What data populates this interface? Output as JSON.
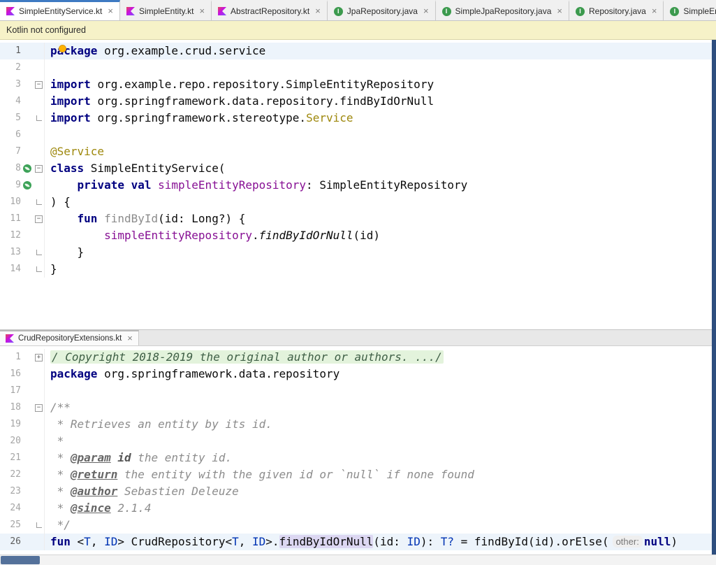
{
  "notification": {
    "text": "Kotlin not configured"
  },
  "icons": {
    "close": "×",
    "fold_minus": "−",
    "fold_plus": "+"
  },
  "colors": {
    "accent_blue": "#3E7AC2",
    "notification_bg": "#F6F2C8",
    "caret_line_bg": "#EDF4FB",
    "keyword": "#000080",
    "annotation": "#9E880D",
    "property": "#871094",
    "comment": "#8C8C8C",
    "folded_region_bg": "#E3F3DC",
    "declaration_highlight": "#DCD7F2",
    "spring_green": "#3DA258",
    "scrollbar_thumb_blue": "#54719A",
    "right_stripe_navy": "#2E4E7E"
  },
  "tabs": [
    {
      "label": "SimpleEntityService.kt",
      "icon": "kotlin",
      "active": true
    },
    {
      "label": "SimpleEntity.kt",
      "icon": "kotlin",
      "active": false
    },
    {
      "label": "AbstractRepository.kt",
      "icon": "kotlin",
      "active": false
    },
    {
      "label": "JpaRepository.java",
      "icon": "interface",
      "active": false
    },
    {
      "label": "SimpleJpaRepository.java",
      "icon": "interface",
      "active": false
    },
    {
      "label": "Repository.java",
      "icon": "interface",
      "active": false
    },
    {
      "label": "SimpleEntityRe",
      "icon": "interface",
      "active": false
    }
  ],
  "bottom_tab": {
    "label": "CrudRepositoryExtensions.kt",
    "icon": "kotlin",
    "active": true
  },
  "editors": [
    {
      "name": "SimpleEntityService.kt",
      "lines": [
        {
          "num": "1",
          "caret": true,
          "tokens": [
            [
              "kw",
              "package "
            ],
            [
              "pl",
              "org.example.crud.service"
            ]
          ]
        },
        {
          "num": "2",
          "tokens": []
        },
        {
          "num": "3",
          "fold": "minus",
          "tokens": [
            [
              "kw",
              "import "
            ],
            [
              "pl",
              "org.example.repo.repository.SimpleEntityRepository"
            ]
          ]
        },
        {
          "num": "4",
          "tokens": [
            [
              "kw",
              "import "
            ],
            [
              "pl",
              "org.springframework.data.repository.findByIdOrNull"
            ]
          ]
        },
        {
          "num": "5",
          "fold": "end",
          "tokens": [
            [
              "kw",
              "import "
            ],
            [
              "pl",
              "org.springframework.stereotype."
            ],
            [
              "ann",
              "Service"
            ]
          ]
        },
        {
          "num": "6",
          "tokens": []
        },
        {
          "num": "7",
          "tokens": [
            [
              "ann",
              "@Service"
            ]
          ]
        },
        {
          "num": "8",
          "gutter": [
            "spring"
          ],
          "fold": "minus",
          "tokens": [
            [
              "kw",
              "class "
            ],
            [
              "pl",
              "SimpleEntityService("
            ]
          ]
        },
        {
          "num": "9",
          "gutter": [
            "spring"
          ],
          "tokens": [
            [
              "pl",
              "    "
            ],
            [
              "kw",
              "private "
            ],
            [
              "kw",
              "val "
            ],
            [
              "prop",
              "simpleEntityRepository"
            ],
            [
              "pl",
              ": SimpleEntityRepository"
            ]
          ]
        },
        {
          "num": "10",
          "fold": "end",
          "tokens": [
            [
              "pl",
              ") {"
            ]
          ]
        },
        {
          "num": "11",
          "fold": "minus",
          "tokens": [
            [
              "pl",
              "    "
            ],
            [
              "kw",
              "fun "
            ],
            [
              "gray",
              "findById"
            ],
            [
              "pl",
              "(id: Long?) {"
            ]
          ]
        },
        {
          "num": "12",
          "tokens": [
            [
              "pl",
              "        "
            ],
            [
              "prop",
              "simpleEntityRepository"
            ],
            [
              "pl",
              "."
            ],
            [
              "ext",
              "findByIdOrNull"
            ],
            [
              "pl",
              "(id)"
            ]
          ]
        },
        {
          "num": "13",
          "fold": "end",
          "tokens": [
            [
              "pl",
              "    }"
            ]
          ]
        },
        {
          "num": "14",
          "fold": "end",
          "tokens": [
            [
              "pl",
              "}"
            ]
          ]
        }
      ]
    },
    {
      "name": "CrudRepositoryExtensions.kt",
      "lines": [
        {
          "num": "1",
          "fold": "plus",
          "tokens": [
            [
              "folded",
              "/ Copyright 2018-2019 the original author or authors. .../"
            ]
          ]
        },
        {
          "num": "16",
          "tokens": [
            [
              "kw",
              "package "
            ],
            [
              "pl",
              "org.springframework.data.repository"
            ]
          ]
        },
        {
          "num": "17",
          "tokens": []
        },
        {
          "num": "18",
          "fold": "minus",
          "tokens": [
            [
              "cmt",
              "/**"
            ]
          ]
        },
        {
          "num": "19",
          "tokens": [
            [
              "cmt",
              " * Retrieves an entity by its id."
            ]
          ]
        },
        {
          "num": "20",
          "tokens": [
            [
              "cmt",
              " *"
            ]
          ]
        },
        {
          "num": "21",
          "tokens": [
            [
              "cmt",
              " * "
            ],
            [
              "tag",
              "@param"
            ],
            [
              "tagval",
              " id"
            ],
            [
              "cmt",
              " the entity id."
            ]
          ]
        },
        {
          "num": "22",
          "tokens": [
            [
              "cmt",
              " * "
            ],
            [
              "tag",
              "@return"
            ],
            [
              "cmt",
              " the entity with the given id or `null` if none found"
            ]
          ]
        },
        {
          "num": "23",
          "tokens": [
            [
              "cmt",
              " * "
            ],
            [
              "tag",
              "@author"
            ],
            [
              "cmt",
              " Sebastien Deleuze"
            ]
          ]
        },
        {
          "num": "24",
          "tokens": [
            [
              "cmt",
              " * "
            ],
            [
              "tag",
              "@since"
            ],
            [
              "cmt",
              " 2.1.4"
            ]
          ]
        },
        {
          "num": "25",
          "fold": "end",
          "tokens": [
            [
              "cmt",
              " */"
            ]
          ]
        },
        {
          "num": "26",
          "caret": true,
          "tokens": [
            [
              "kw",
              "fun "
            ],
            [
              "pl",
              "<"
            ],
            [
              "typ",
              "T"
            ],
            [
              "pl",
              ", "
            ],
            [
              "typ",
              "ID"
            ],
            [
              "pl",
              "> CrudRepository<"
            ],
            [
              "typ",
              "T"
            ],
            [
              "pl",
              ", "
            ],
            [
              "typ",
              "ID"
            ],
            [
              "pl",
              ">."
            ],
            [
              "decl",
              "findByIdOrNull"
            ],
            [
              "pl",
              "(id: "
            ],
            [
              "typ",
              "ID"
            ],
            [
              "pl",
              "): "
            ],
            [
              "typ",
              "T?"
            ],
            [
              "pl",
              " = findById(id).orElse("
            ],
            [
              "hint",
              "other:"
            ],
            [
              "kw",
              "null"
            ],
            [
              "pl",
              ")"
            ]
          ]
        }
      ]
    }
  ]
}
